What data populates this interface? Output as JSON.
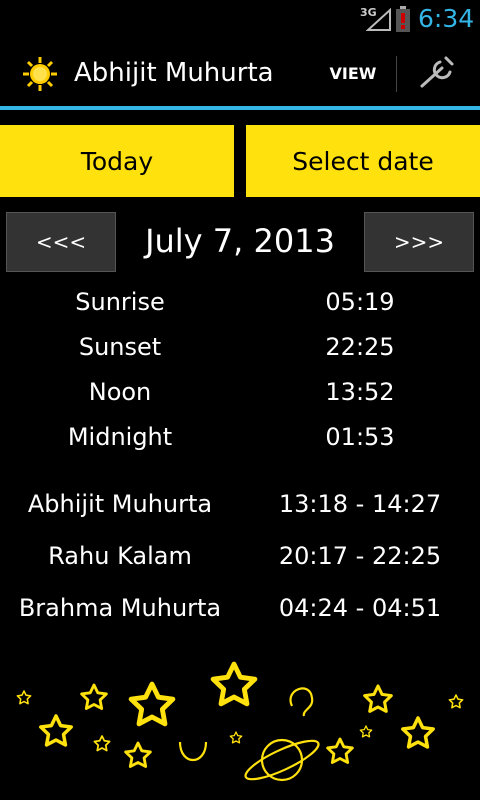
{
  "status": {
    "network": "3G",
    "time": "6:34"
  },
  "app": {
    "title": "Abhijit Muhurta",
    "view_label": "VIEW"
  },
  "tabs": {
    "today": "Today",
    "select_date": "Select date"
  },
  "nav": {
    "prev": "<<<",
    "next": ">>>",
    "date": "July 7, 2013"
  },
  "times": [
    {
      "label": "Sunrise",
      "value": "05:19"
    },
    {
      "label": "Sunset",
      "value": "22:25"
    },
    {
      "label": "Noon",
      "value": "13:52"
    },
    {
      "label": "Midnight",
      "value": "01:53"
    }
  ],
  "periods": [
    {
      "label": "Abhijit Muhurta",
      "value": "13:18  -  14:27"
    },
    {
      "label": "Rahu Kalam",
      "value": "20:17  -  22:25"
    },
    {
      "label": "Brahma Muhurta",
      "value": "04:24  -  04:51"
    }
  ],
  "colors": {
    "accent": "#ffe10e",
    "holo_blue": "#33b5e5",
    "battery_warning": "#cc0000"
  }
}
